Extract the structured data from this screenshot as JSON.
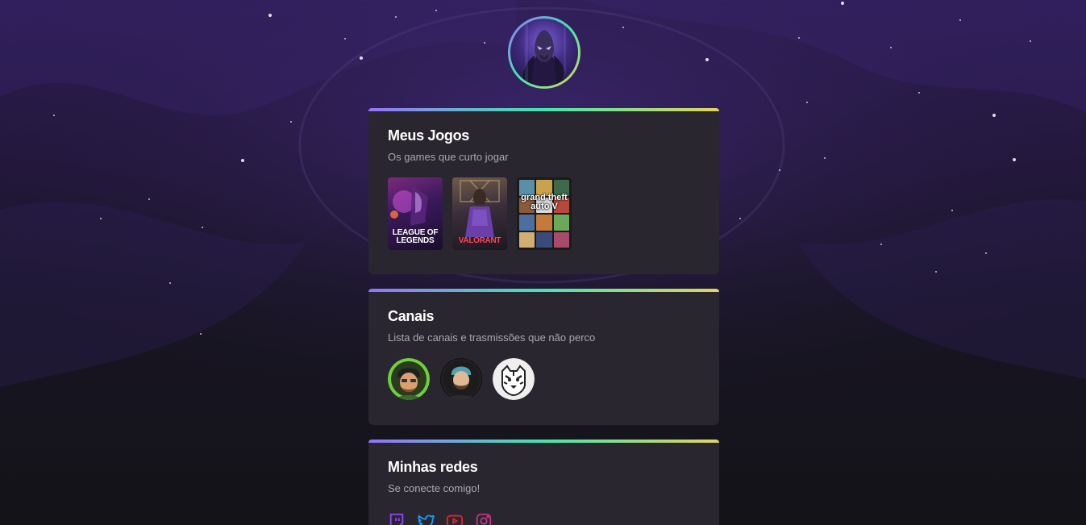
{
  "profile": {
    "avatar_icon": "avatar-icon"
  },
  "games_card": {
    "title": "Meus Jogos",
    "subtitle": "Os games que curto jogar",
    "games": [
      {
        "label": "LEAGUE OF LEGENDS",
        "icon": "league-of-legends-cover"
      },
      {
        "label": "VALORANT",
        "icon": "valorant-cover"
      },
      {
        "label": "grand theft auto V",
        "icon": "gta-v-cover"
      }
    ]
  },
  "channels_card": {
    "title": "Canais",
    "subtitle": "Lista de canais e trasmissões que não perco",
    "channels": [
      {
        "icon": "channel-avatar-1"
      },
      {
        "icon": "channel-avatar-2"
      },
      {
        "icon": "channel-avatar-3"
      }
    ]
  },
  "social_card": {
    "title": "Minhas redes",
    "subtitle": "Se conecte comigo!",
    "networks": [
      {
        "icon": "twitch-icon",
        "color": "#9146ff"
      },
      {
        "icon": "twitter-icon",
        "color": "#1d9bf0"
      },
      {
        "icon": "youtube-icon",
        "color": "#e1252c"
      },
      {
        "icon": "instagram-icon",
        "color": "#c13584"
      }
    ]
  },
  "theme": {
    "card_background": "#29262f",
    "gradient_start": "#9572fc",
    "gradient_mid": "#43e7ad",
    "gradient_end": "#e2d45c"
  }
}
